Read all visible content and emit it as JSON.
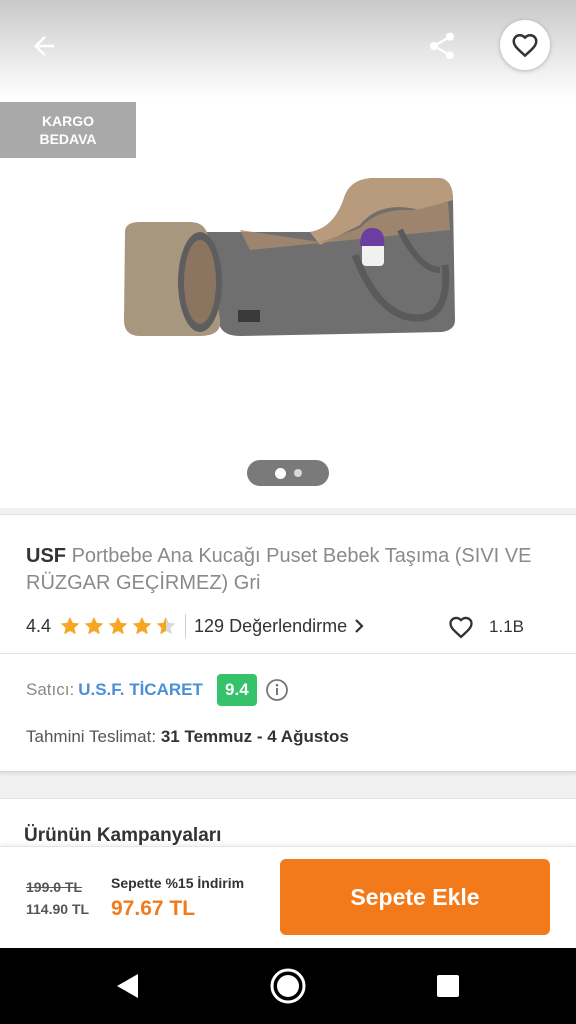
{
  "header": {
    "back_icon": "arrow-left-icon",
    "share_icon": "share-icon",
    "favorite_icon": "heart-outline-icon"
  },
  "gallery": {
    "badge_line1": "KARGO",
    "badge_line2": "BEDAVA",
    "image_alt": "Portbebe gray baby carrier bag with bottle",
    "pages": 2,
    "current_page": 1
  },
  "product": {
    "brand": "USF",
    "name": "Portbebe Ana Kucağı Puset Bebek Taşıma (SIVI VE RÜZGAR GEÇİRMEZ) Gri",
    "rating": "4.4",
    "stars": 4.5,
    "reviews_label": "129 Değerlendirme",
    "likes_count": "1.1B"
  },
  "seller": {
    "label": "Satıcı:",
    "name": "U.S.F. TİCARET",
    "score": "9.4"
  },
  "delivery": {
    "label": "Tahmini Teslimat:",
    "dates": "31 Temmuz - 4 Ağustos"
  },
  "campaign": {
    "title": "Ürünün Kampanyaları"
  },
  "pricing": {
    "old_price": "199.0 TL",
    "discounted_price": "114.90 TL",
    "promo_text": "Sepette %15 İndirim",
    "final_price": "97.67 TL",
    "add_to_cart_label": "Sepete Ekle"
  },
  "colors": {
    "accent": "#f27a1a",
    "seller_link": "#4a90d9",
    "score_badge": "#35c26b",
    "star": "#f5a623"
  },
  "system_nav": {
    "back": "nav-back-icon",
    "home": "nav-home-icon",
    "recents": "nav-recents-icon"
  }
}
